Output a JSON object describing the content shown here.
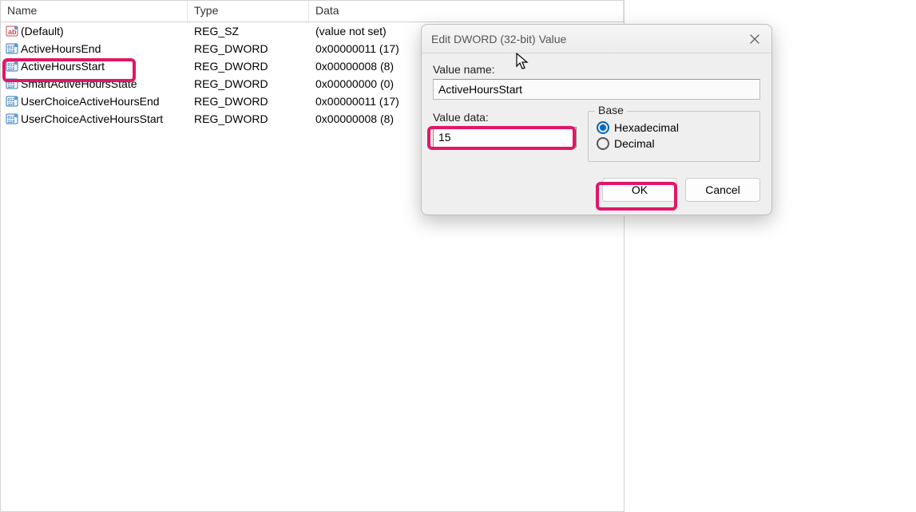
{
  "header": {
    "name": "Name",
    "type": "Type",
    "data": "Data"
  },
  "registry_rows": [
    {
      "icon": "string",
      "name": "(Default)",
      "type": "REG_SZ",
      "data": "(value not set)"
    },
    {
      "icon": "dword",
      "name": "ActiveHoursEnd",
      "type": "REG_DWORD",
      "data": "0x00000011 (17)"
    },
    {
      "icon": "dword",
      "name": "ActiveHoursStart",
      "type": "REG_DWORD",
      "data": "0x00000008 (8)"
    },
    {
      "icon": "dword",
      "name": "SmartActiveHoursState",
      "type": "REG_DWORD",
      "data": "0x00000000 (0)"
    },
    {
      "icon": "dword",
      "name": "UserChoiceActiveHoursEnd",
      "type": "REG_DWORD",
      "data": "0x00000011 (17)"
    },
    {
      "icon": "dword",
      "name": "UserChoiceActiveHoursStart",
      "type": "REG_DWORD",
      "data": "0x00000008 (8)"
    }
  ],
  "dialog": {
    "title": "Edit DWORD (32-bit) Value",
    "value_name_label": "Value name:",
    "value_name": "ActiveHoursStart",
    "value_data_label": "Value data:",
    "value_data": "15",
    "base_label": "Base",
    "hex_label": "Hexadecimal",
    "dec_label": "Decimal",
    "base_selected": "hex",
    "ok_label": "OK",
    "cancel_label": "Cancel"
  },
  "highlights": {
    "row_active_hours_start": true,
    "value_data_input": true,
    "ok_button": true
  },
  "colors": {
    "accent_pink": "#e21667",
    "accent_blue": "#0067c0"
  }
}
